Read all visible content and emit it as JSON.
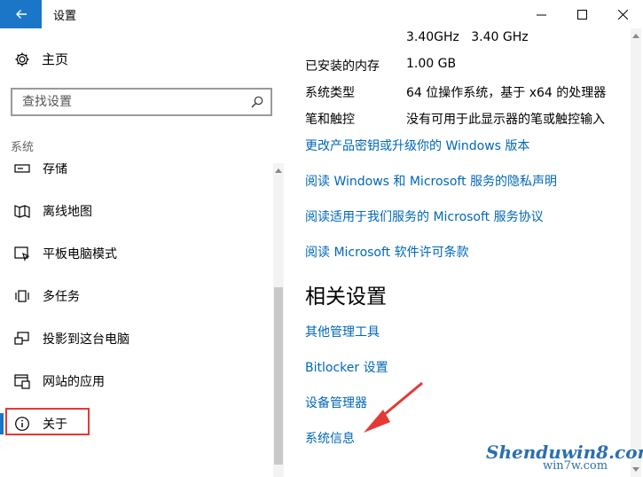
{
  "window": {
    "title": "设置"
  },
  "sidebar": {
    "home_label": "主页",
    "search_placeholder": "查找设置",
    "section_title": "系统",
    "items": [
      {
        "label": "存储",
        "icon": "storage-icon"
      },
      {
        "label": "离线地图",
        "icon": "map-icon"
      },
      {
        "label": "平板电脑模式",
        "icon": "tablet-mode-icon"
      },
      {
        "label": "多任务",
        "icon": "multitasking-icon"
      },
      {
        "label": "投影到这台电脑",
        "icon": "project-icon"
      },
      {
        "label": "网站的应用",
        "icon": "apps-for-websites-icon"
      },
      {
        "label": "关于",
        "icon": "info-icon",
        "active": true
      }
    ]
  },
  "main": {
    "specs": [
      {
        "key": "",
        "value": "3.40GHz   3.40 GHz"
      },
      {
        "key": "已安装的内存",
        "value": "1.00 GB"
      },
      {
        "key": "系统类型",
        "value": "64 位操作系统，基于 x64 的处理器"
      },
      {
        "key": "笔和触控",
        "value": "没有可用于此显示器的笔或触控输入"
      }
    ],
    "links": [
      "更改产品密钥或升级你的 Windows 版本",
      "阅读 Windows 和 Microsoft 服务的隐私声明",
      "阅读适用于我们服务的 Microsoft 服务协议",
      "阅读 Microsoft 软件许可条款"
    ],
    "related_title": "相关设置",
    "related_links": [
      "其他管理工具",
      "Bitlocker 设置",
      "设备管理器",
      "系统信息"
    ]
  },
  "watermark": {
    "text": "Shenduwin8.com",
    "sub": "win7w.com"
  },
  "colors": {
    "accent": "#1b76c8",
    "link": "#0067b8",
    "annotation": "#e53935"
  }
}
